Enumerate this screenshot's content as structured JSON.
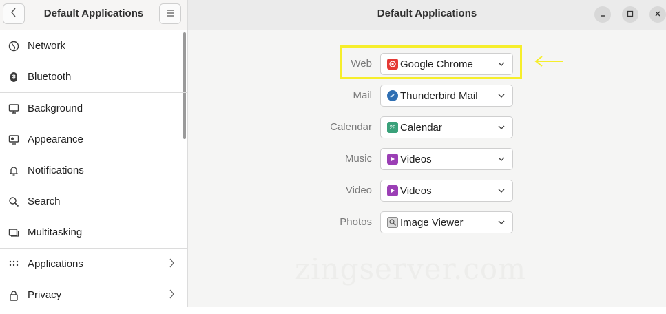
{
  "sidebar": {
    "title": "Default Applications",
    "items": [
      {
        "label": "Network",
        "icon": "globe-icon"
      },
      {
        "label": "Bluetooth",
        "icon": "bluetooth-icon"
      },
      {
        "label": "Background",
        "icon": "display-icon"
      },
      {
        "label": "Appearance",
        "icon": "appearance-icon"
      },
      {
        "label": "Notifications",
        "icon": "bell-icon"
      },
      {
        "label": "Search",
        "icon": "search-icon"
      },
      {
        "label": "Multitasking",
        "icon": "multitasking-icon"
      },
      {
        "label": "Applications",
        "icon": "grid-icon"
      },
      {
        "label": "Privacy",
        "icon": "lock-icon"
      }
    ]
  },
  "header": {
    "title": "Default Applications"
  },
  "defaults": [
    {
      "label": "Web",
      "app": "Google Chrome",
      "icon": "chrome-icon",
      "color": "#e53935"
    },
    {
      "label": "Mail",
      "app": "Thunderbird Mail",
      "icon": "thunderbird-icon",
      "color": "#2f6fb3"
    },
    {
      "label": "Calendar",
      "app": "Calendar",
      "icon": "calendar-icon",
      "color": "#3aa17a",
      "badge": "28"
    },
    {
      "label": "Music",
      "app": "Videos",
      "icon": "videos-icon",
      "color": "#9b3fb5"
    },
    {
      "label": "Video",
      "app": "Videos",
      "icon": "videos-icon",
      "color": "#9b3fb5"
    },
    {
      "label": "Photos",
      "app": "Image Viewer",
      "icon": "image-viewer-icon",
      "color": "#8a8a8a"
    }
  ],
  "watermark": "zingserver.com",
  "colors": {
    "highlight": "#f6ee2b",
    "arrow": "#f6ee2b"
  }
}
